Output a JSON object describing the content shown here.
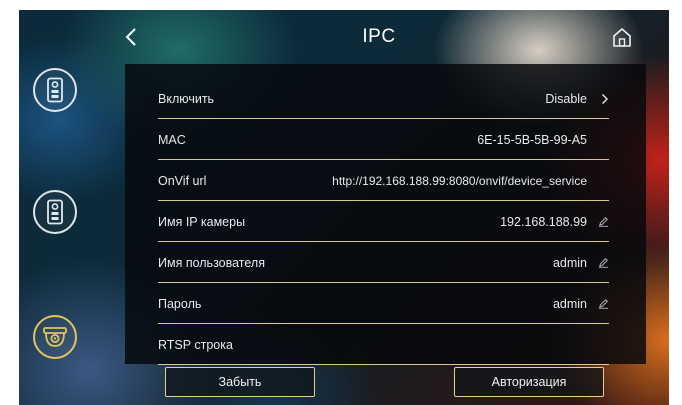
{
  "header": {
    "title": "IPC"
  },
  "sidebar": {
    "items": [
      {
        "icon": "door-station-icon"
      },
      {
        "icon": "door-station-icon"
      },
      {
        "icon": "camera-icon",
        "active": true
      }
    ]
  },
  "settings": {
    "rows": [
      {
        "label": "Включить",
        "value": "Disable",
        "action": "chevron-right-icon"
      },
      {
        "label": "MAC",
        "value": "6E-15-5B-5B-99-A5"
      },
      {
        "label": "OnVif url",
        "value": "http://192.168.188.99:8080/onvif/device_service"
      },
      {
        "label": "Имя IP камеры",
        "value": "192.168.188.99",
        "action": "edit-icon"
      },
      {
        "label": "Имя пользователя",
        "value": "admin",
        "action": "edit-icon"
      },
      {
        "label": "Пароль",
        "value": "admin",
        "action": "edit-icon"
      },
      {
        "label": "RTSP строка",
        "value": ""
      }
    ]
  },
  "footer": {
    "forget_label": "Забыть",
    "authorize_label": "Авторизация"
  },
  "colors": {
    "accent_line": "#d9c98c",
    "button_border": "#e3cf86",
    "active_icon_ring": "#e5c35c",
    "text": "#e9eaec"
  }
}
